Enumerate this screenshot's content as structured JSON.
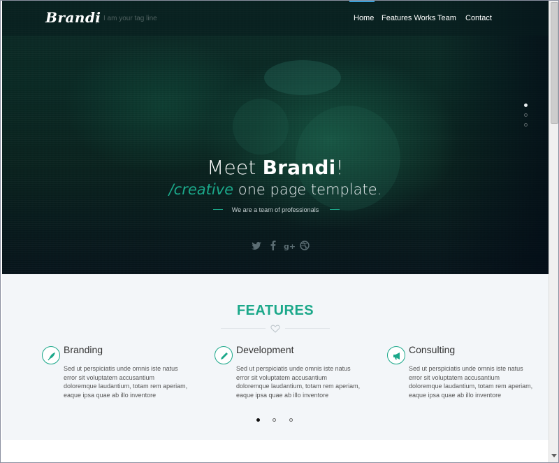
{
  "brand": {
    "logo": "Brandi",
    "tagline": "I am your tag line"
  },
  "nav": {
    "home": "Home",
    "features_works": "Features Works",
    "team": "Team",
    "contact": "Contact"
  },
  "hero": {
    "title_prefix": "Meet ",
    "title_bold": "Brandi",
    "title_suffix": "!",
    "subtitle_accent": "/creative",
    "subtitle_rest": " one page template.",
    "team_text": "We are a team of professionals",
    "slide_count": 3,
    "active_slide": 1
  },
  "socials": [
    "twitter-icon",
    "facebook-icon",
    "google-plus-icon",
    "dribbble-icon"
  ],
  "features": {
    "title": "FEATURES",
    "items": [
      {
        "icon": "feather-icon",
        "heading": "Branding",
        "text": "Sed ut perspiciatis unde omnis iste natus error sit voluptatem accusantium doloremque laudantium, totam rem aperiam, eaque ipsa quae ab illo inventore"
      },
      {
        "icon": "pencil-icon",
        "heading": "Development",
        "text": "Sed ut perspiciatis unde omnis iste natus error sit voluptatem accusantium doloremque laudantium, totam rem aperiam, eaque ipsa quae ab illo inventore"
      },
      {
        "icon": "megaphone-icon",
        "heading": "Consulting",
        "text": "Sed ut perspiciatis unde omnis iste natus error sit voluptatem accusantium doloremque laudantium, totam rem aperiam, eaque ipsa quae ab illo inventore"
      }
    ],
    "page_count": 3,
    "active_page": 1
  },
  "colors": {
    "accent": "#1ba88a",
    "hero_bg": "#0a231f",
    "section_bg": "#f3f6f9"
  }
}
